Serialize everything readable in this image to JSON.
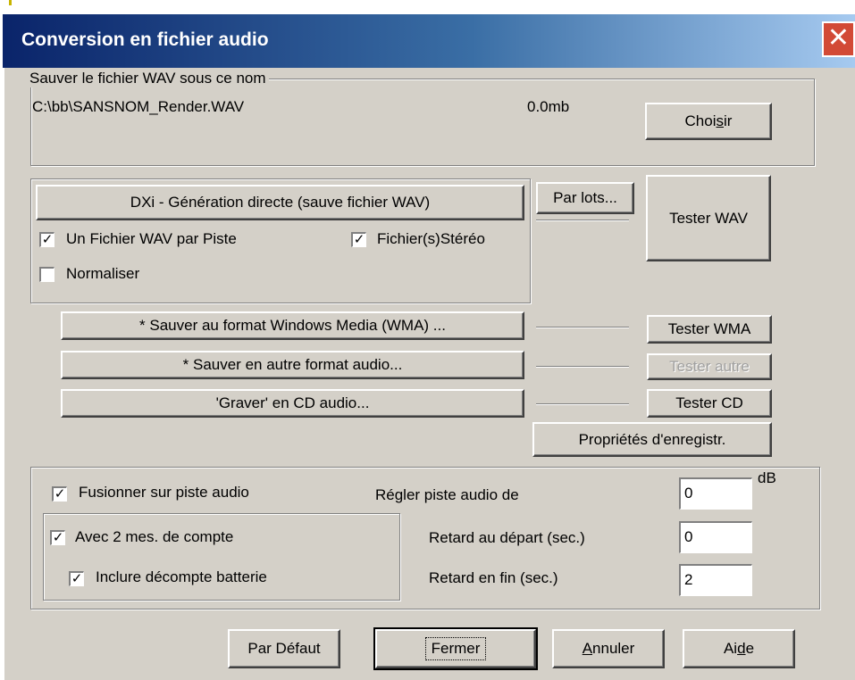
{
  "window": {
    "title": "Conversion en fichier audio",
    "close_symbol": "✕"
  },
  "save": {
    "legend": "Sauver le fichier WAV sous ce nom",
    "path": "C:\\bb\\SANSNOM_Render.WAV",
    "size": "0.0mb",
    "choose_pre": "Choi",
    "choose_key": "s",
    "choose_post": "ir"
  },
  "render": {
    "dxi_label": "DXi - Génération directe (sauve fichier WAV)",
    "batch_label": "Par lots...",
    "test_wav_label": "Tester WAV",
    "one_wav_per_track": {
      "label": "Un Fichier WAV par Piste",
      "checked": true
    },
    "stereo": {
      "label": "Fichier(s)Stéréo",
      "checked": true
    },
    "normalize": {
      "label": "Normaliser",
      "checked": false
    }
  },
  "formats": {
    "wma_label": "* Sauver au format Windows Media (WMA) ...",
    "test_wma_label": "Tester WMA",
    "other_label": "* Sauver en autre format audio...",
    "test_other_label": "Tester autre",
    "cd_label": "'Graver' en CD audio...",
    "test_cd_label": "Tester CD",
    "props_label": "Propriétés d'enregistr."
  },
  "merge": {
    "merge_track": {
      "label": "Fusionner sur piste audio",
      "checked": true
    },
    "count_in": {
      "label": "Avec 2 mes. de compte",
      "checked": true
    },
    "drum_countdown": {
      "label": "Inclure décompte batterie",
      "checked": true
    },
    "adjust_label": "Régler piste audio de",
    "adjust_value": "0",
    "db_unit": "dB",
    "start_delay_label": "Retard au départ (sec.)",
    "start_delay_value": "0",
    "end_delay_label": "Retard en fin (sec.)",
    "end_delay_value": "2"
  },
  "footer": {
    "default_label": "Par Défaut",
    "close_label": "Fermer",
    "cancel_key": "A",
    "cancel_rest": "nnuler",
    "help_pre": "Ai",
    "help_key": "d",
    "help_post": "e"
  }
}
